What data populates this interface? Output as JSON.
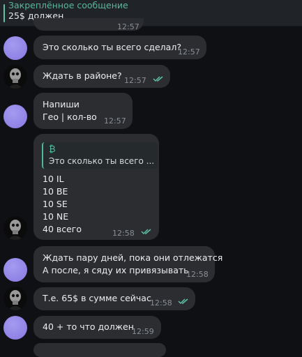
{
  "pinned": {
    "title": "Закреплённое сообщение",
    "text": "25$ должен"
  },
  "messages": [
    {
      "partial_time": "12:57"
    },
    {
      "text": "Это сколько ты всего сделал?",
      "time": "12:57"
    },
    {
      "text": "Ждать в районе?",
      "time": "12:57"
    },
    {
      "lines": [
        "Напиши",
        "Гео | кол-во"
      ],
      "time": "12:57"
    },
    {
      "quote_icon": "₿",
      "quote_text": "Это сколько ты всего ...",
      "lines": [
        "10 IL",
        "10 BE",
        "10 SE",
        "10 NE",
        "40 всего"
      ],
      "time": "12:58"
    },
    {
      "lines": [
        "Ждать пару дней, пока они отлежатся",
        "А после, я сяду их привязывать"
      ],
      "time": "12:58"
    },
    {
      "text": "Т.е. 65$ в сумме сейчас",
      "time": "12:58"
    },
    {
      "text": "40 + то что должен",
      "time": "12:59"
    }
  ],
  "colors": {
    "accent": "#5fc1a6",
    "bubble": "#2b2d31",
    "background": "#0e1013",
    "avatar_purple": "#9488ea"
  },
  "icons": {
    "read_receipt": "double-check-icon",
    "pinned_bar": "pinned-bar-icon"
  }
}
